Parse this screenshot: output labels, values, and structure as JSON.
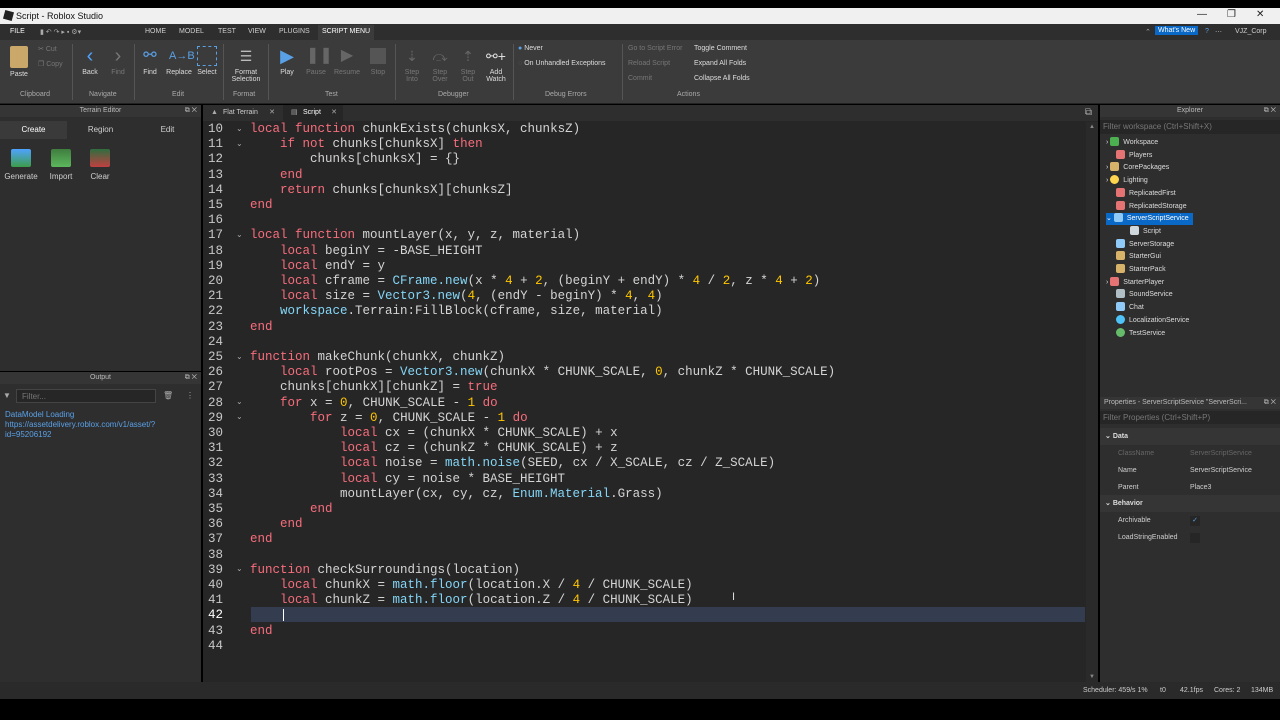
{
  "window": {
    "title": "Script - Roblox Studio"
  },
  "menu": {
    "file": "FILE",
    "tabs": [
      "HOME",
      "MODEL",
      "TEST",
      "VIEW",
      "PLUGINS",
      "SCRIPT MENU"
    ],
    "whats_new": "What's New",
    "user": "VJZ_Corp"
  },
  "ribbon": {
    "clipboard": {
      "paste": "Paste",
      "cut": "Cut",
      "copy": "Copy",
      "group": "Clipboard"
    },
    "navigate": {
      "back": "Back",
      "find": "Find",
      "group": "Navigate"
    },
    "edit": {
      "find": "Find",
      "replace": "Replace",
      "select": "Select",
      "group": "Edit"
    },
    "format": {
      "format_selection": "Format Selection",
      "group": "Format"
    },
    "test": {
      "play": "Play",
      "pause": "Pause",
      "resume": "Resume",
      "stop": "Stop",
      "group": "Test"
    },
    "debugger": {
      "step_into": "Step Into",
      "step_over": "Step Over",
      "step_out": "Step Out",
      "add_watch": "Add Watch",
      "group": "Debugger"
    },
    "debug_errors": {
      "never": "Never",
      "unhandled": "On Unhandled Exceptions",
      "group": "Debug Errors"
    },
    "actions": {
      "go_to_script_error": "Go to Script Error",
      "reload_script": "Reload Script",
      "commit": "Commit",
      "toggle_comment": "Toggle Comment",
      "expand_all": "Expand All Folds",
      "collapse_all": "Collapse All Folds",
      "group": "Actions"
    }
  },
  "terrain": {
    "title": "Terrain Editor",
    "tabs": [
      "Create",
      "Region",
      "Edit"
    ],
    "tools": [
      "Generate",
      "Import",
      "Clear"
    ]
  },
  "output": {
    "title": "Output",
    "filter_placeholder": "Filter...",
    "log": "DataModel Loading https://assetdelivery.roblox.com/v1/asset/?id=95206192"
  },
  "editor": {
    "tabs": [
      "Flat Terrain",
      "Script"
    ]
  },
  "explorer": {
    "title": "Explorer",
    "filter_placeholder": "Filter workspace (Ctrl+Shift+X)",
    "items": [
      "Workspace",
      "Players",
      "CorePackages",
      "Lighting",
      "ReplicatedFirst",
      "ReplicatedStorage",
      "ServerScriptService",
      "Script",
      "ServerStorage",
      "StarterGui",
      "StarterPack",
      "StarterPlayer",
      "SoundService",
      "Chat",
      "LocalizationService",
      "TestService"
    ]
  },
  "properties": {
    "title": "Properties - ServerScriptService \"ServerScri...",
    "filter_placeholder": "Filter Properties (Ctrl+Shift+P)",
    "sections": {
      "data": "Data",
      "behavior": "Behavior"
    },
    "rows": [
      {
        "name": "ClassName",
        "value": "ServerScriptService"
      },
      {
        "name": "Name",
        "value": "ServerScriptService"
      },
      {
        "name": "Parent",
        "value": "Place3"
      },
      {
        "name": "Archivable",
        "value": "✓"
      },
      {
        "name": "LoadStringEnabled",
        "value": ""
      }
    ]
  },
  "status": {
    "scheduler": "Scheduler: 459/s 1%",
    "t": "t0",
    "fps": "42.1fps",
    "cores": "Cores: 2",
    "mem": "134MB"
  },
  "colors": {
    "keyword": "#f86d7c",
    "builtin": "#84d6f7",
    "number": "#ffc600",
    "selection": "#0a68c6"
  }
}
